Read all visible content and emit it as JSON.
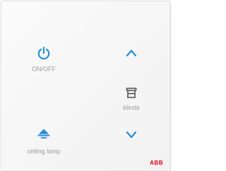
{
  "panel": {
    "accent_color": "#2a8fd6",
    "label_color": "#9a9a9a",
    "buttons": {
      "power": {
        "label": "ON/OFF",
        "icon": "power-icon"
      },
      "blinds_up": {
        "icon": "triangle-up-icon"
      },
      "blinds": {
        "label": "blinds",
        "icon": "blinds-icon"
      },
      "ceiling_lamp": {
        "label": "ceiling lamp",
        "icon": "ceiling-lamp-icon"
      },
      "blinds_down": {
        "icon": "triangle-down-icon"
      }
    },
    "brand": {
      "text": "ABB",
      "color": "#e2001a"
    }
  }
}
